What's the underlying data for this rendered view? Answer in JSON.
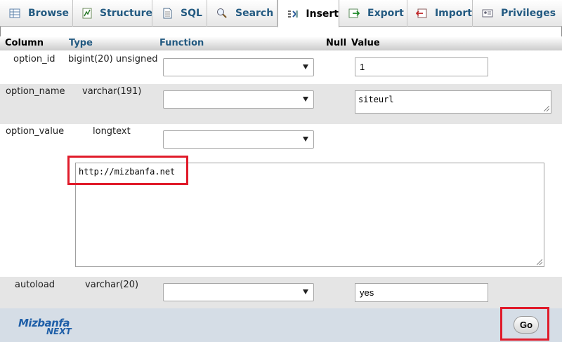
{
  "tabs": [
    {
      "label": "Browse",
      "icon": "browse-icon"
    },
    {
      "label": "Structure",
      "icon": "structure-icon"
    },
    {
      "label": "SQL",
      "icon": "sql-icon"
    },
    {
      "label": "Search",
      "icon": "search-icon"
    },
    {
      "label": "Insert",
      "icon": "insert-icon",
      "active": true
    },
    {
      "label": "Export",
      "icon": "export-icon"
    },
    {
      "label": "Import",
      "icon": "import-icon"
    },
    {
      "label": "Privileges",
      "icon": "privileges-icon"
    }
  ],
  "table_header": {
    "column": "Column",
    "type": "Type",
    "function": "Function",
    "null": "Null",
    "value": "Value"
  },
  "rows": [
    {
      "column": "option_id",
      "type": "bigint(20) unsigned",
      "function": "",
      "value": "1"
    },
    {
      "column": "option_name",
      "type": "varchar(191)",
      "function": "",
      "value": "siteurl"
    },
    {
      "column": "option_value",
      "type": "longtext",
      "function": "",
      "value": "http://mizbanfa.net"
    },
    {
      "column": "autoload",
      "type": "varchar(20)",
      "function": "",
      "value": "yes"
    }
  ],
  "footer": {
    "go_label": "Go",
    "logo_line1": "Mizbanfa",
    "logo_line2": "NEXT"
  },
  "colors": {
    "link": "#235a81",
    "highlight": "#e01b2a",
    "footer_bg": "#d5dde6",
    "row_alt": "#e5e5e5"
  }
}
